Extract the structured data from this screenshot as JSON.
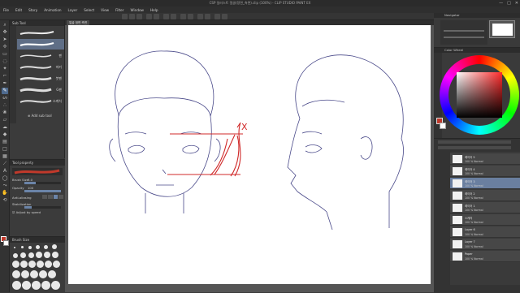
{
  "window": {
    "title": "CSP 일러스트 얼굴(정면_측면).clip (100%) - CLIP STUDIO PAINT EX",
    "controls": [
      "—",
      "□",
      "✕"
    ]
  },
  "menu": [
    "File",
    "Edit",
    "Story",
    "Animation",
    "Layer",
    "Select",
    "View",
    "Filter",
    "Window",
    "Help"
  ],
  "canvas": {
    "tab_label": "얼굴 정면 측면"
  },
  "subtool": {
    "header": "Sub Tool",
    "brushes": [
      {
        "label": ""
      },
      {
        "label": ""
      },
      {
        "label": "펜"
      },
      {
        "label": "마커"
      },
      {
        "label": "붓펜"
      },
      {
        "label": "G펜"
      },
      {
        "label": "스케치"
      },
      {
        "label": ""
      }
    ],
    "add_label": "Add sub tool"
  },
  "toolprop": {
    "header": "Tool property",
    "brush_size_label": "Brush Size",
    "brush_size_value": "3.0",
    "opacity_label": "Opacity",
    "opacity_value": "100",
    "antialias_label": "Anti-aliasing",
    "stabilize_label": "Stabilization",
    "adjust_label": "Adjust by speed"
  },
  "brushsize": {
    "header": "Brush Size"
  },
  "navigator": {
    "header": "Navigator"
  },
  "color": {
    "header": "Color Wheel",
    "accent": "#c0392b"
  },
  "layers": {
    "items": [
      {
        "name": "레이어 5",
        "sub": "100 % Normal"
      },
      {
        "name": "레이어 4",
        "sub": "100 % Normal"
      },
      {
        "name": "레이어 3",
        "sub": "100 % Normal"
      },
      {
        "name": "레이어 2",
        "sub": "100 % Normal"
      },
      {
        "name": "레이어 1",
        "sub": "100 % Normal"
      },
      {
        "name": "스케치",
        "sub": "100 % Normal"
      },
      {
        "name": "Layer 6",
        "sub": "100 % Normal"
      },
      {
        "name": "Layer 7",
        "sub": "100 % Normal"
      },
      {
        "name": "Paper",
        "sub": "100 % Normal"
      }
    ]
  },
  "annotation": {
    "mark": "X"
  }
}
